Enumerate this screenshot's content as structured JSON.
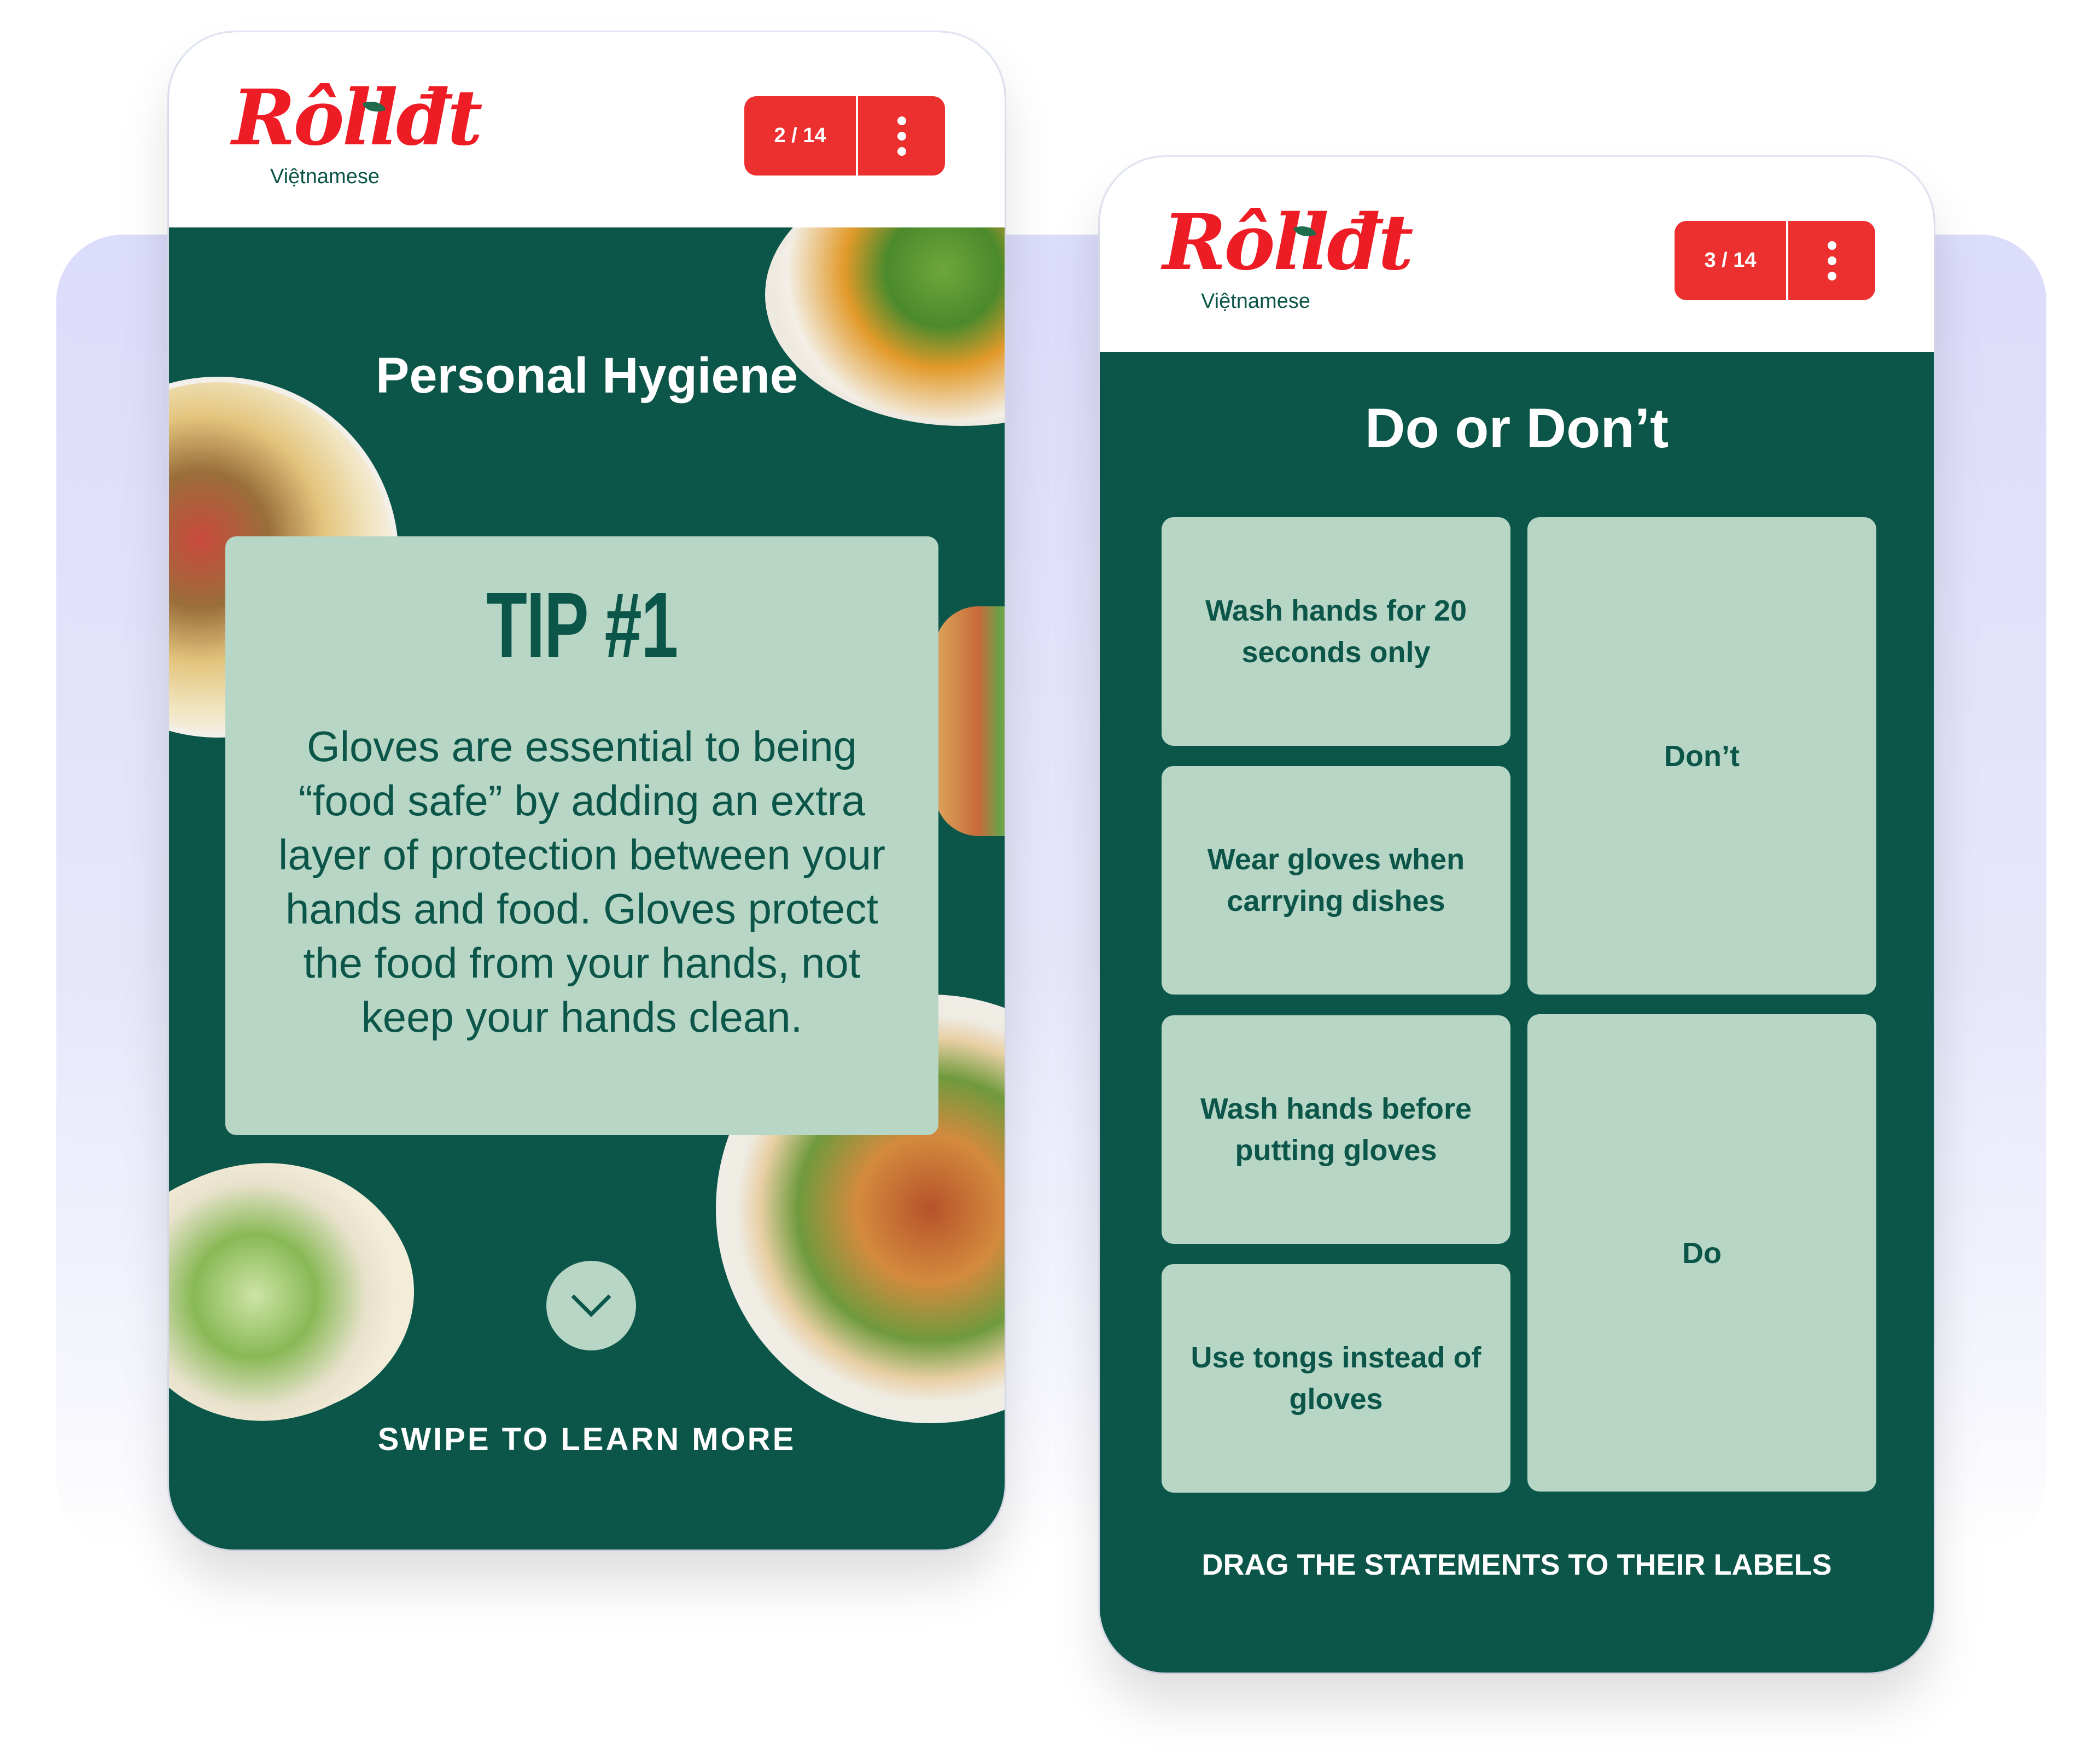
{
  "screens": [
    {
      "brand": {
        "name": "Rôllđt",
        "subtitle": "Việtnamese"
      },
      "progress": {
        "current": 2,
        "total": 14,
        "label": "2 / 14"
      },
      "menu_icon": "more-vertical-icon",
      "title": "Personal Hygiene",
      "tip": {
        "heading": "TIP #1",
        "body": "Gloves are essential to being “food safe” by adding an extra layer of protection between your hands and food. Gloves protect the food from your hands, not keep your hands clean."
      },
      "next_icon": "chevron-down-icon",
      "footer": "SWIPE TO LEARN MORE"
    },
    {
      "brand": {
        "name": "Rôllđt",
        "subtitle": "Việtnamese"
      },
      "progress": {
        "current": 3,
        "total": 14,
        "label": "3 / 14"
      },
      "menu_icon": "more-vertical-icon",
      "title": "Do or Don’t",
      "statements": [
        "Wash hands for 20 seconds only",
        "Wear gloves when carrying dishes",
        "Wash hands before putting gloves",
        "Use tongs instead of gloves"
      ],
      "labels": [
        "Don’t",
        "Do"
      ],
      "footer": "DRAG THE STATEMENTS TO THEIR LABELS"
    }
  ],
  "colors": {
    "brand_red": "#eb302f",
    "dark_green": "#0c5549",
    "mint": "#b8d6c6",
    "lavender": "#dcdcfb"
  }
}
